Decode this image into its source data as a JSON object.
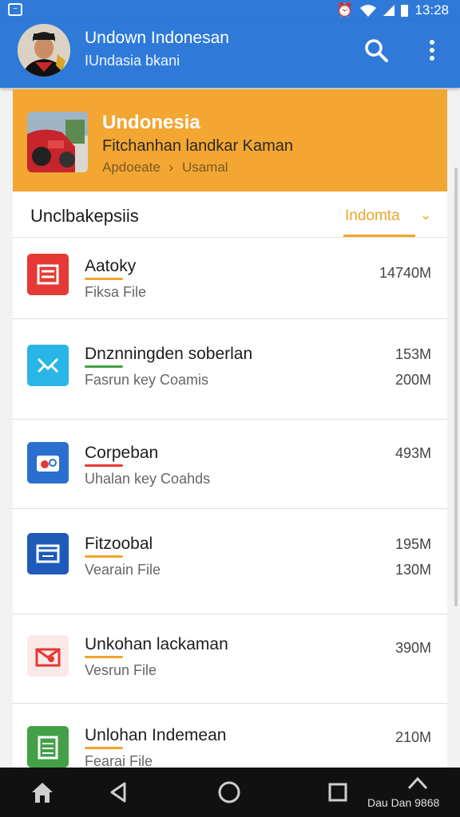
{
  "status_bar": {
    "time": "13:28",
    "icons": [
      "notification-icon",
      "alarm-icon",
      "wifi-icon",
      "signal-icon",
      "battery-icon"
    ]
  },
  "app_bar": {
    "title": "Undown Indonesan",
    "subtitle": "IUndasia bkani",
    "actions": [
      "search-icon",
      "more-vert-icon"
    ]
  },
  "banner": {
    "title": "Undonesia",
    "subtitle": "Fitchanhan landkar Kaman",
    "breadcrumb_left": "Apdoeate",
    "breadcrumb_sep": "›",
    "breadcrumb_right": "Usamal"
  },
  "section": {
    "title": "Unclbakepsiis",
    "filter_label": "Indomta",
    "filter_chevron": "⌄"
  },
  "items": [
    {
      "name": "Aatoky",
      "sub": "Fiksa File",
      "size1": "14740M",
      "size2": "",
      "icon": "document-list-icon",
      "icon_color": "#e53935",
      "accent": "#f0a52a"
    },
    {
      "name": "Dnznningden soberlan",
      "sub": "Fasrun key Coamis",
      "size1": "153M",
      "size2": "200M",
      "icon": "mail-icon",
      "icon_color": "#29b6e6",
      "accent": "#43a047"
    },
    {
      "name": "Corpeban",
      "sub": "Uhalan key Coahds",
      "size1": "493M",
      "size2": "",
      "icon": "photo-icon",
      "icon_color": "#2a6fce",
      "accent": "#e53935"
    },
    {
      "name": "Fitzoobal",
      "sub": "Vearain File",
      "size1": "195M",
      "size2": "130M",
      "icon": "folder-window-icon",
      "icon_color": "#1e5bb8",
      "accent": "#f0a52a"
    },
    {
      "name": "Unkohan lackaman",
      "sub": "Vesrun File",
      "size1": "390M",
      "size2": "",
      "icon": "calendar-icon",
      "icon_color": "#fbe9e7",
      "accent": "#f0a52a"
    },
    {
      "name": "Unlohan Indemean",
      "sub": "Fearai File",
      "size1": "210M",
      "size2": "",
      "icon": "spreadsheet-icon",
      "icon_color": "#43a047",
      "accent": "#f0a52a"
    }
  ],
  "nav_bar": {
    "buttons": [
      "home-icon",
      "back-icon",
      "circle-home-icon",
      "recents-icon",
      "upload-icon"
    ],
    "label": "Dau Dan 9868"
  }
}
